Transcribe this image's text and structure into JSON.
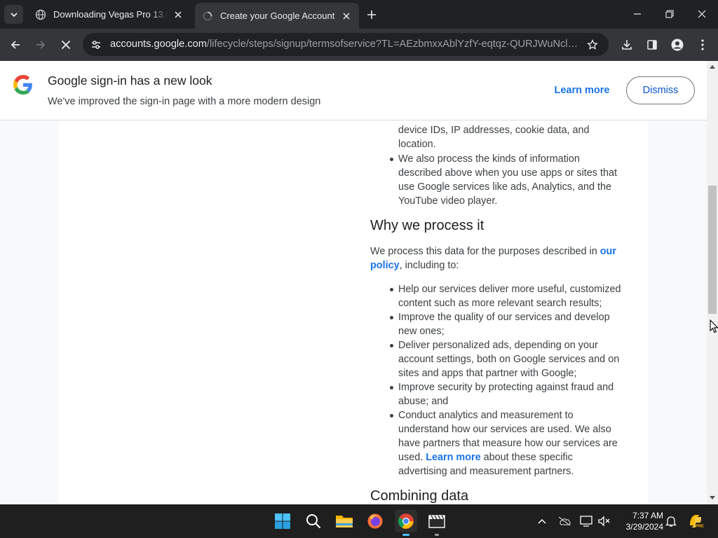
{
  "browser": {
    "tabs": [
      {
        "title": "Downloading Vegas Pro 13.0 Bu",
        "active": false
      },
      {
        "title": "Create your Google Account",
        "active": true
      }
    ],
    "address": {
      "host": "accounts.google.com",
      "path": "/lifecycle/steps/signup/termsofservice?TL=AEzbmxxAblYzfY-eqtqz-QURJWuNcl0Na1w..."
    }
  },
  "banner": {
    "title": "Google sign-in has a new look",
    "subtitle": "We've improved the sign-in page with a more modern design",
    "learn_more": "Learn more",
    "dismiss": "Dismiss"
  },
  "content": {
    "partial_line": "device IDs, IP addresses, cookie data, and location.",
    "bullet_also": "We also process the kinds of information described above when you use apps or sites that use Google services like ads, Analytics, and the YouTube video player.",
    "why_heading": "Why we process it",
    "why_intro_pre": "We process this data for the purposes described in",
    "why_intro_link": "our policy",
    "why_intro_post": ", including to:",
    "purposes": [
      "Help our services deliver more useful, customized content such as more relevant search results;",
      "Improve the quality of our services and develop new ones;",
      "Deliver personalized ads, depending on your account settings, both on Google services and on sites and apps that partner with Google;",
      "Improve security by protecting against fraud and abuse; and"
    ],
    "analytics_pre": "Conduct analytics and measurement to understand how our services are used. We also have partners that measure how our services are used.",
    "analytics_link": "Learn more",
    "analytics_post": "about these specific advertising and measurement partners.",
    "combining_heading": "Combining data"
  },
  "taskbar": {
    "time": "7:37 AM",
    "date": "3/29/2024"
  },
  "colors": {
    "link": "#1a73e8",
    "chrome_dark": "#202124",
    "toolbar": "#35363a",
    "taskbar": "#1f1f1f"
  }
}
